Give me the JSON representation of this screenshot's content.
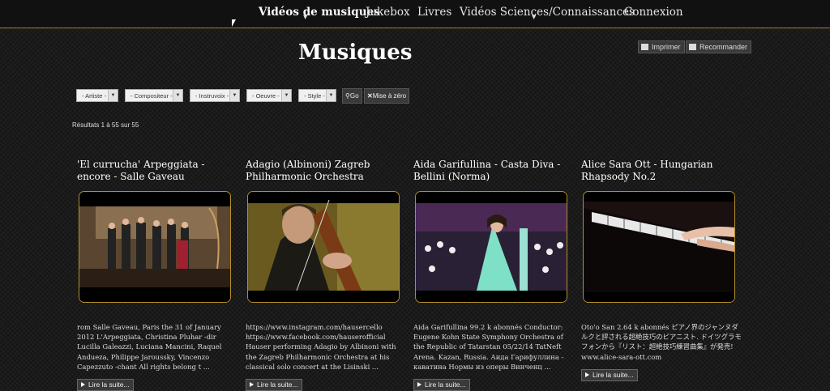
{
  "nav": {
    "items": [
      {
        "label": "Vidéos de musiques",
        "has_dropdown": true,
        "active": true
      },
      {
        "label": "Jukebox",
        "has_dropdown": false
      },
      {
        "label": "Livres",
        "has_dropdown": false
      },
      {
        "label": "Vidéos Sciences/Connaissances",
        "has_dropdown": true
      },
      {
        "label": "Connexion",
        "has_dropdown": false
      }
    ]
  },
  "utility": {
    "print_label": "Imprimer",
    "recommend_label": "Recommander"
  },
  "page": {
    "title": "Musiques"
  },
  "filters": {
    "artist": "- Artiste -",
    "composer": "- Compositeur -",
    "instrument": "- Instruvoix -",
    "work": "- Oeuvre -",
    "style": "- Style -",
    "go_label": "Go",
    "reset_label": "Mise à zéro"
  },
  "results_text": "Résultats 1 à 55 sur 55",
  "cards": [
    {
      "title": "'El currucha' Arpeggiata - encore - Salle Gaveau",
      "description": "rom Salle Gaveau, Paris the 31 of January 2012 L'Arpeggiata, Christina Pluhar -dir Lucilla Galeazzi, Luciana Mancini, Raquel Andueza, Philippe Jaroussky, Vincenzo Capezzuto -chant All rights belong t ...",
      "more_label": "Lire la suite..."
    },
    {
      "title": "Adagio (Albinoni) Zagreb Philharmonic Orchestra",
      "description": "https://www.instagram.com/hausercello https://www.facebook.com/hauserofficial Hauser performing Adagio by Albinoni with the Zagreb Philharmonic Orchestra at his classical solo concert at the Lisinski ...",
      "more_label": "Lire la suite..."
    },
    {
      "title": "Aida Garifullina - Casta Diva - Bellini (Norma)",
      "description": "Aida Garifullina 99.2 k abonnés Conductor: Eugene Kohn State Symphony Orchestra of the Republic of Tatarstan 05/22/14 TatNeft Arena. Kazan, Russia. Аида Гарифуллина - каватина Нормы из оперы Винченц ...",
      "more_label": "Lire la suite..."
    },
    {
      "title": "Alice Sara Ott - Hungarian Rhapsody No.2",
      "description": "Oto'o San 2.64 k abonnés ピアノ界のジャンヌダルクと評される超絶技巧のピアニスト. ドイツグラモフォンから『リスト：超絶技巧練習曲集』が発売! www.alice-sara-ott.com",
      "more_label": "Lire la suite..."
    }
  ]
}
